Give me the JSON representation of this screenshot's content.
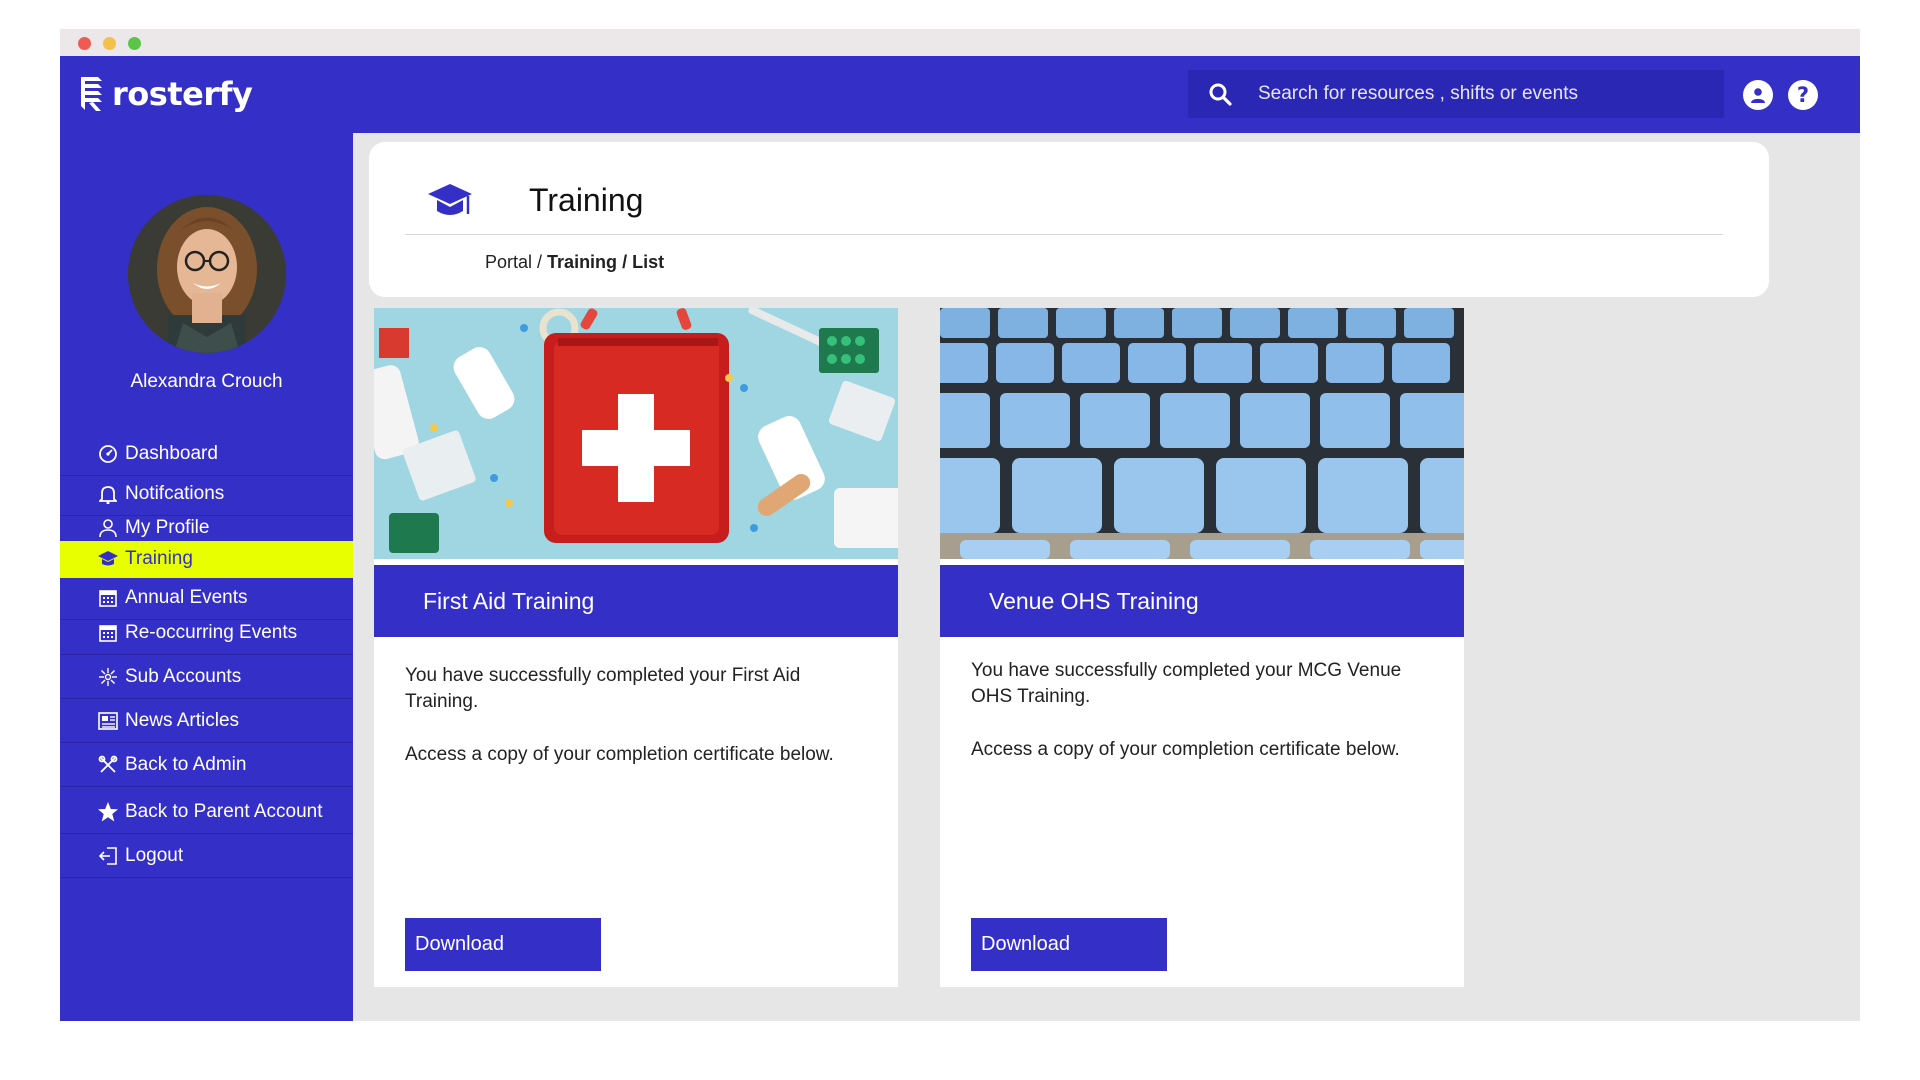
{
  "app": {
    "logo_text": "rosterfy",
    "brand_color": "#3430c7",
    "active_color": "#e8ff00"
  },
  "search": {
    "placeholder": "Search for resources , shifts or events",
    "value": ""
  },
  "topbar_icons": [
    "user-circle-icon",
    "help-circle-icon"
  ],
  "help_glyph": "?",
  "user": {
    "name": "Alexandra Crouch"
  },
  "sidebar": {
    "items": [
      {
        "label": "Dashboard",
        "icon": "dashboard-icon",
        "active": false
      },
      {
        "label": "Notifcations",
        "icon": "bell-icon",
        "active": false
      },
      {
        "label": "My Profile",
        "icon": "person-icon",
        "active": false
      },
      {
        "label": "Training",
        "icon": "graduation-cap-icon",
        "active": true
      },
      {
        "label": "Annual Events",
        "icon": "calendar-icon",
        "active": false
      },
      {
        "label": "Re-occurring Events",
        "icon": "calendar-icon",
        "active": false
      },
      {
        "label": "Sub Accounts",
        "icon": "network-icon",
        "active": false
      },
      {
        "label": "News Articles",
        "icon": "newspaper-icon",
        "active": false
      },
      {
        "label": "Back to Admin",
        "icon": "tools-icon",
        "active": false
      },
      {
        "label": "Back to Parent Account",
        "icon": "star-icon",
        "active": false
      },
      {
        "label": "Logout",
        "icon": "logout-icon",
        "active": false
      }
    ]
  },
  "page": {
    "title": "Training",
    "breadcrumb": {
      "root": "Portal",
      "separator1": " / ",
      "section": "Training",
      "separator2": " / ",
      "current": "List"
    }
  },
  "cards": [
    {
      "title": "First Aid Training",
      "image": "first-aid-kit-image",
      "text1": "You have successfully completed your First Aid Training.",
      "text2": "Access a copy of your completion certificate below.",
      "button": "Download"
    },
    {
      "title": "Venue OHS Training",
      "image": "stadium-seats-image",
      "text1": "You have successfully completed your MCG Venue OHS Training.",
      "text2": "Access a copy of your completion certificate below.",
      "button": "Download"
    }
  ]
}
